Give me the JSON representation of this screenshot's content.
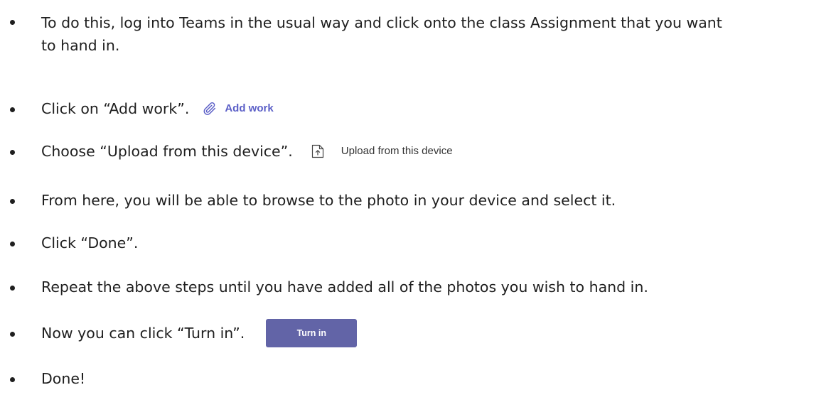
{
  "steps": [
    {
      "line1": "To do this, log into Teams in the usual way and click onto the class Assignment that you want",
      "line2": "to hand in."
    },
    {
      "text": "Click on “Add work”.",
      "button_label": "Add work",
      "icon": "paperclip-icon"
    },
    {
      "text": "Choose “Upload from this device”.",
      "button_label": "Upload from this device",
      "icon": "upload-file-icon"
    },
    {
      "text": "From here, you will be able to browse to the photo in your device and select it."
    },
    {
      "text": "Click “Done”."
    },
    {
      "text": "Repeat the above steps until you have added all of the photos you wish to hand in."
    },
    {
      "text": "Now you can click “Turn in”.",
      "button_label": "Turn in"
    },
    {
      "text": "Done!"
    }
  ],
  "colors": {
    "teams_purple_text": "#5b5fc7",
    "teams_button": "#6264a7",
    "body_text": "#1f1f1f"
  }
}
